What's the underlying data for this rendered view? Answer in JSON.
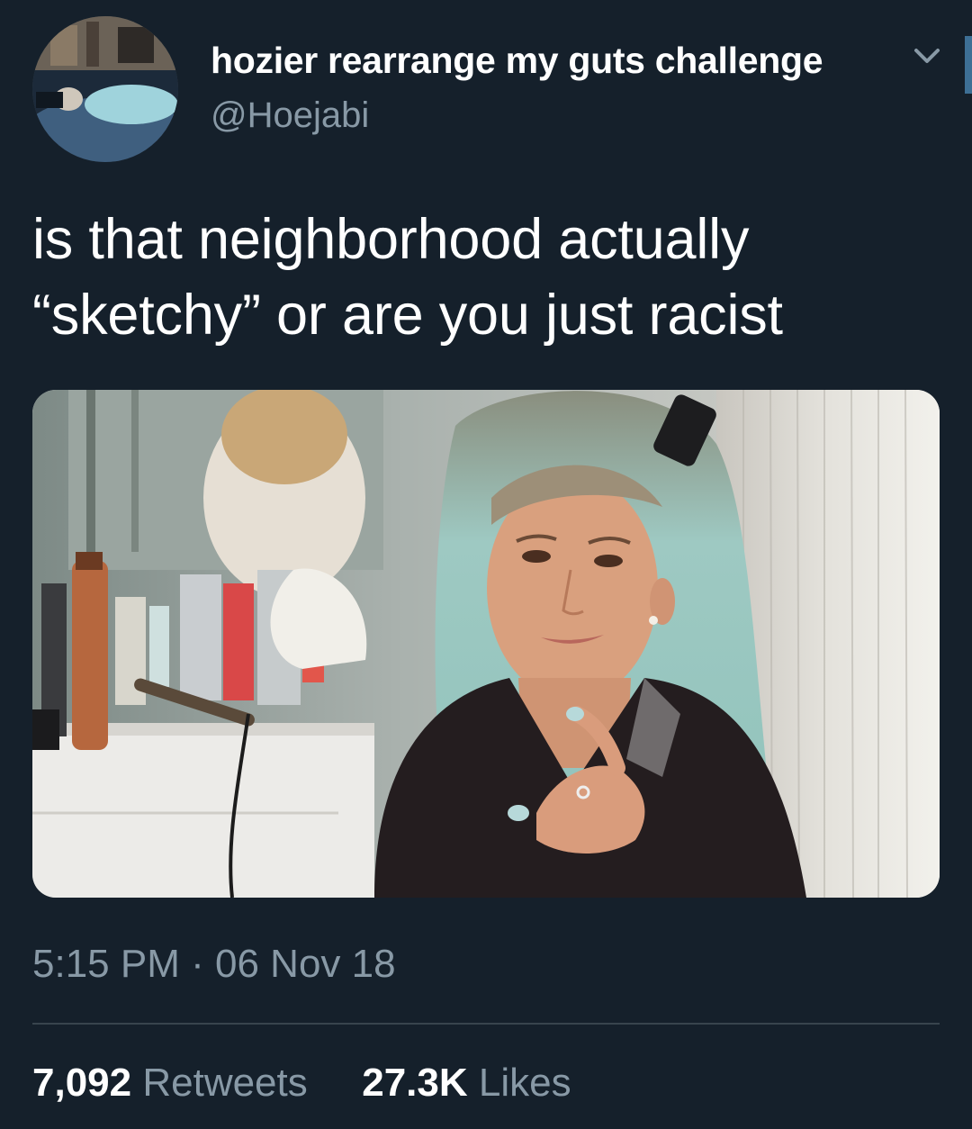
{
  "author": {
    "display_name": "hozier rearrange my guts challenge",
    "handle": "@Hoejabi"
  },
  "menu_icon": "chevron-down-icon",
  "tweet": {
    "text": "is that neighborhood actually\n“sketchy” or are you just racist"
  },
  "meta": {
    "time": "5:15 PM",
    "separator": "·",
    "date": "06 Nov 18"
  },
  "stats": {
    "retweets_count": "7,092",
    "retweets_label": "Retweets",
    "likes_count": "27.3K",
    "likes_label": "Likes"
  },
  "colors": {
    "background": "#15202b",
    "secondary_text": "#8899a6",
    "divider": "#38444d",
    "primary_text": "#ffffff"
  }
}
